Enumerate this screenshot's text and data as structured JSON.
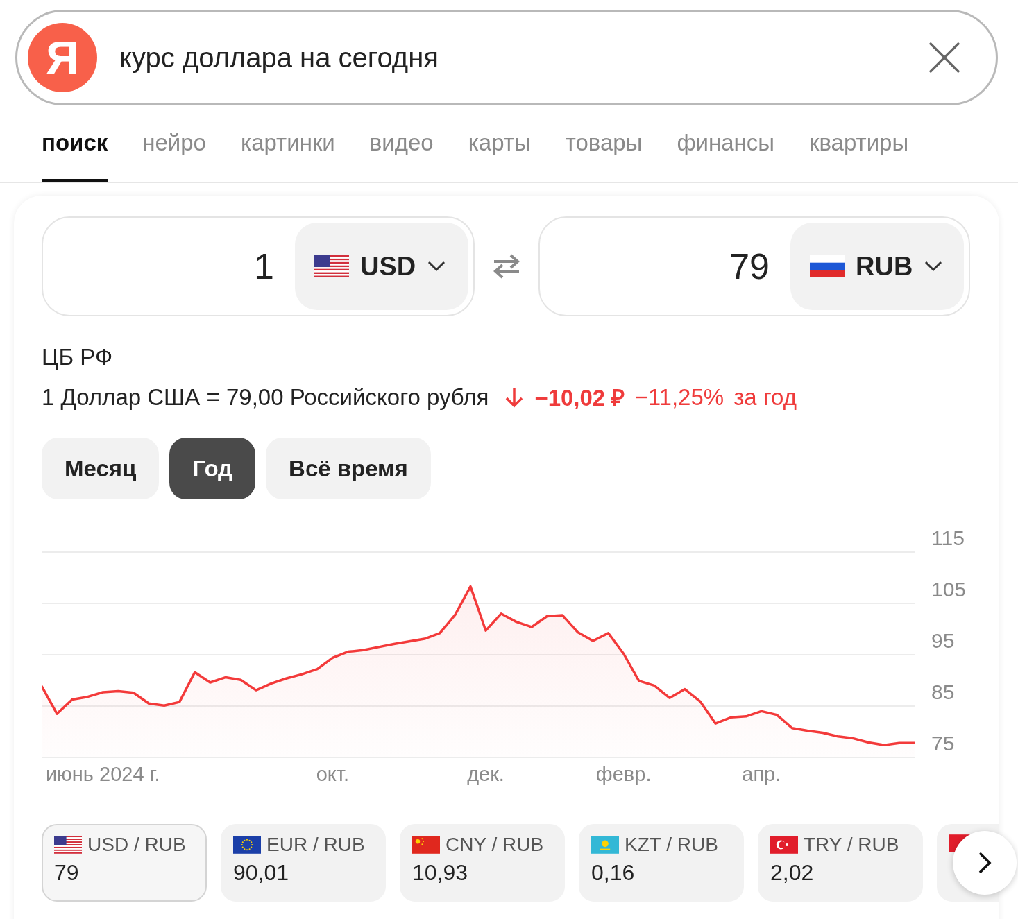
{
  "search": {
    "logo_letter": "Я",
    "query": "курс доллара на сегодня"
  },
  "tabs": [
    {
      "label": "поиск",
      "selected": true
    },
    {
      "label": "нейро",
      "selected": false
    },
    {
      "label": "картинки",
      "selected": false
    },
    {
      "label": "видео",
      "selected": false
    },
    {
      "label": "карты",
      "selected": false
    },
    {
      "label": "товары",
      "selected": false
    },
    {
      "label": "финансы",
      "selected": false
    },
    {
      "label": "квартиры",
      "selected": false
    }
  ],
  "converter": {
    "from": {
      "amount": "1",
      "kind": "us",
      "code": "USD"
    },
    "to": {
      "amount": "79",
      "kind": "ru",
      "code": "RUB"
    }
  },
  "source": "ЦБ РФ",
  "rate": {
    "text": "1 Доллар США = 79,00 Российского рубля",
    "change": "−10,02 ₽",
    "percent": "−11,25%",
    "period": "за год"
  },
  "periods": [
    {
      "label": "Месяц",
      "selected": false
    },
    {
      "label": "Год",
      "selected": true
    },
    {
      "label": "Всё время",
      "selected": false
    }
  ],
  "chart_data": {
    "type": "area",
    "grid": true,
    "categories": [
      null,
      null,
      null,
      null,
      "июнь 2024 г.",
      null,
      null,
      null,
      null,
      null,
      null,
      null,
      null,
      null,
      null,
      null,
      null,
      null,
      null,
      "окт.",
      null,
      null,
      null,
      null,
      null,
      null,
      null,
      null,
      null,
      "дек.",
      null,
      null,
      null,
      null,
      null,
      null,
      null,
      null,
      "февр.",
      null,
      null,
      null,
      null,
      null,
      null,
      null,
      null,
      "апр.",
      null,
      null,
      null,
      null,
      null,
      null,
      null,
      null,
      null,
      null
    ],
    "series": [
      {
        "color": "#f33a3a",
        "values": [
          88.9,
          83.5,
          86.3,
          86.8,
          87.7,
          87.9,
          87.6,
          85.5,
          85.1,
          85.8,
          91.6,
          89.6,
          90.6,
          90.1,
          88.1,
          89.4,
          90.4,
          91.2,
          92.2,
          94.4,
          95.6,
          95.9,
          96.5,
          97.1,
          97.6,
          98.1,
          99.2,
          102.8,
          108.3,
          99.7,
          103,
          101.4,
          100.4,
          102.5,
          102.7,
          99.4,
          97.7,
          99.2,
          95.2,
          89.9,
          89,
          86.6,
          88.3,
          85.9,
          81.6,
          82.8,
          83,
          84,
          83.3,
          80.7,
          80.2,
          79.8,
          79.1,
          78.7,
          77.9,
          77.4,
          77.8,
          77.8
        ]
      }
    ],
    "ylim": [
      75,
      115
    ],
    "yticks": [
      75,
      85,
      95,
      105,
      115
    ]
  },
  "pairs": [
    {
      "kind": "us",
      "pair": "USD / RUB",
      "value": "79",
      "selected": true
    },
    {
      "kind": "eu",
      "pair": "EUR / RUB",
      "value": "90,01",
      "selected": false
    },
    {
      "kind": "cn",
      "pair": "CNY / RUB",
      "value": "10,93",
      "selected": false
    },
    {
      "kind": "kz",
      "pair": "KZT / RUB",
      "value": "0,16",
      "selected": false
    },
    {
      "kind": "tr",
      "pair": "TRY / RUB",
      "value": "2,02",
      "selected": false
    },
    {
      "kind": "other",
      "selected": false
    }
  ]
}
